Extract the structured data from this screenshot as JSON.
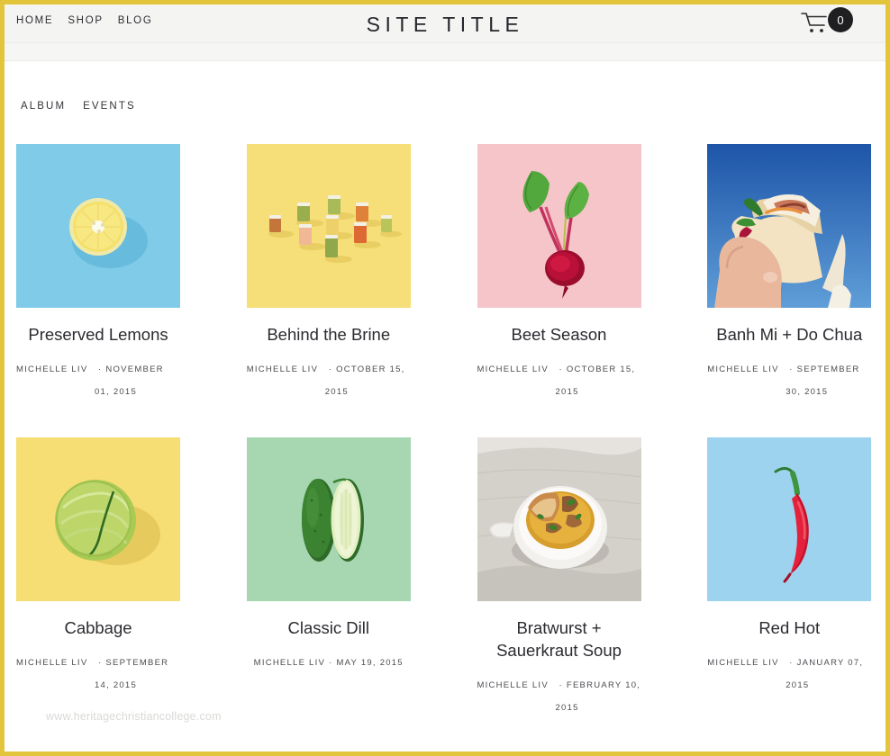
{
  "header": {
    "site_title": "SITE TITLE",
    "nav": [
      {
        "label": "HOME",
        "name": "home"
      },
      {
        "label": "SHOP",
        "name": "shop"
      },
      {
        "label": "BLOG",
        "name": "blog"
      }
    ],
    "cart": {
      "icon": "shopping-cart-icon",
      "count": "0"
    }
  },
  "tabs": [
    {
      "label": "ALBUM",
      "name": "album"
    },
    {
      "label": "EVENTS",
      "name": "events"
    }
  ],
  "albums": [
    {
      "title": "Preserved Lemons",
      "author": "MICHELLE LIV",
      "date": "NOVEMBER 01, 2015",
      "meta_wrapped": true,
      "image": "lemon-half-on-blue"
    },
    {
      "title": "Behind the Brine",
      "author": "MICHELLE LIV",
      "date": "OCTOBER 15, 2015",
      "meta_wrapped": true,
      "image": "pickle-jars-on-yellow"
    },
    {
      "title": "Beet Season",
      "author": "MICHELLE LIV",
      "date": "OCTOBER 15, 2015",
      "meta_wrapped": true,
      "image": "beet-with-greens-on-pink"
    },
    {
      "title": "Banh Mi + Do Chua",
      "author": "MICHELLE LIV",
      "date": "SEPTEMBER 30, 2015",
      "meta_wrapped": true,
      "image": "hand-holding-banh-mi-sky"
    },
    {
      "title": "Cabbage",
      "author": "MICHELLE LIV",
      "date": "SEPTEMBER 14, 2015",
      "meta_wrapped": true,
      "image": "cabbage-on-yellow"
    },
    {
      "title": "Classic Dill",
      "author": "MICHELLE LIV",
      "date": "MAY 19, 2015",
      "meta_wrapped": false,
      "image": "cucumbers-on-mint-green"
    },
    {
      "title": "Bratwurst + Sauerkraut Soup",
      "author": "MICHELLE LIV",
      "date": "FEBRUARY 10, 2015",
      "meta_wrapped": true,
      "image": "soup-bowl-on-linen"
    },
    {
      "title": "Red Hot",
      "author": "MICHELLE LIV",
      "date": "JANUARY 07, 2015",
      "meta_wrapped": true,
      "image": "red-chili-on-blue"
    }
  ],
  "meta_separator": "·",
  "watermark": "www.heritagechristiancollege.com",
  "colors": {
    "page_border": "#e3c53c",
    "header_bg": "#f4f4f2",
    "cart_badge": "#1f1f22",
    "text": "#2b2b31"
  }
}
